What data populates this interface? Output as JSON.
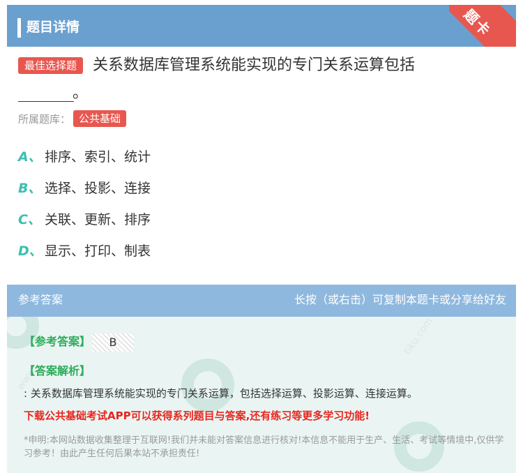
{
  "header": {
    "title": "题目详情",
    "ribbon": "题卡"
  },
  "question": {
    "type_tag": "最佳选择题",
    "text": "关系数据库管理系统能实现的专门关系运算包括",
    "text_end": "。",
    "bank_label": "所属题库：",
    "bank_tag": "公共基础"
  },
  "options": [
    {
      "letter": "A、",
      "text": "排序、索引、统计"
    },
    {
      "letter": "B、",
      "text": "选择、投影、连接"
    },
    {
      "letter": "C、",
      "text": "关联、更新、排序"
    },
    {
      "letter": "D、",
      "text": "显示、打印、制表"
    }
  ],
  "answer": {
    "head_left": "参考答案",
    "head_right": "长按（或右击）可复制本题卡或分享给好友",
    "answer_label": "【参考答案】",
    "answer_value": "B",
    "explain_label": "【答案解析】",
    "explain_text": ": 关系数据库管理系统能实现的专门关系运算，包括选择运算、投影运算、连接运算。",
    "promo": "下载公共基础考试APP可以获得系列题目与答案,还有练习等更多学习功能!",
    "disclaimer": "*申明:本网站数据收集整理于互联网!我们并未能对答案信息进行核对!本信息不能用于生产、生活、考试等情境中,仅供学习参考！由此产生任何后果本站不承担责任!"
  },
  "colors": {
    "header_bg": "#6aa0cf",
    "accent_red": "#e8574f",
    "option_letter": "#3bbfb0",
    "answer_green": "#2eac5b",
    "promo_red": "#e8261f"
  }
}
